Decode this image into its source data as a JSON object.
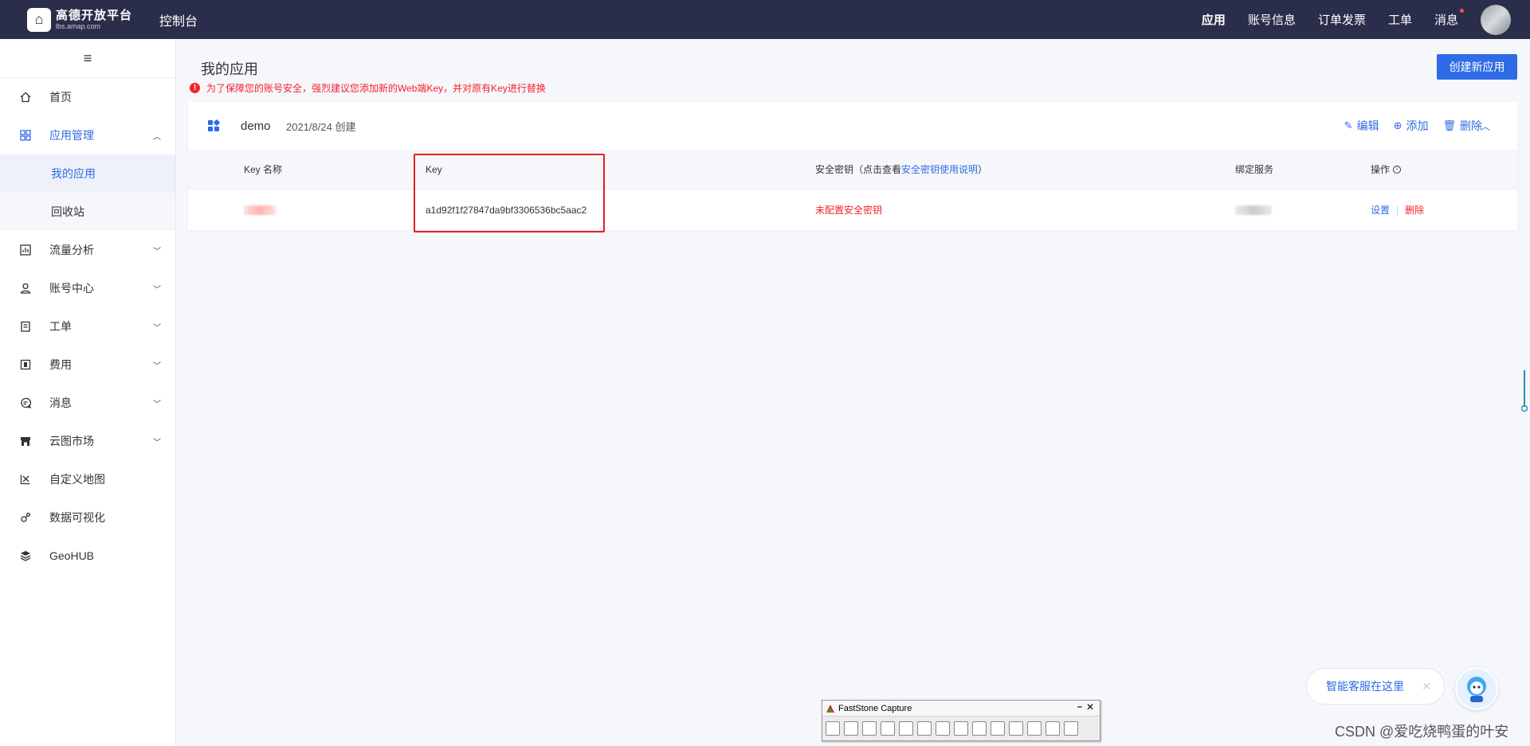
{
  "topbar": {
    "logo_title": "高德开放平台",
    "logo_sub": "lbs.amap.com",
    "console": "控制台",
    "nav": [
      "应用",
      "账号信息",
      "订单发票",
      "工单",
      "消息"
    ]
  },
  "sidebar": {
    "hamburger": "≡",
    "items": {
      "home": "首页",
      "app_manage": "应用管理",
      "my_apps": "我的应用",
      "recycle": "回收站",
      "traffic": "流量分析",
      "account": "账号中心",
      "ticket": "工单",
      "fee": "费用",
      "message": "消息",
      "market": "云图市场",
      "custom_map": "自定义地图",
      "data_vis": "数据可视化",
      "geohub": "GeoHUB"
    }
  },
  "main": {
    "title": "我的应用",
    "create_button": "创建新应用",
    "warning": "为了保障您的账号安全，强烈建议您添加新的Web端Key，并对原有Key进行替换",
    "app": {
      "name": "demo",
      "created": "2021/8/24 创建",
      "actions": {
        "edit": "编辑",
        "add": "添加",
        "delete": "删除"
      }
    },
    "table": {
      "headers": {
        "key_name": "Key 名称",
        "key": "Key",
        "secret_prefix": "安全密钥（点击查看",
        "secret_link": "安全密钥使用说明",
        "secret_suffix": "）",
        "service": "绑定服务",
        "ops": "操作"
      },
      "rows": [
        {
          "key": "a1d92f1f27847da9bf3306536bc5aac2",
          "secret": "未配置安全密钥",
          "op_settings": "设置",
          "op_delete": "删除"
        }
      ]
    }
  },
  "assistant": {
    "label": "智能客服在这里",
    "close": "✕"
  },
  "faststone": {
    "title": "FastStone Capture",
    "min": "–",
    "close": "✕"
  },
  "watermark": "CSDN @爱吃烧鸭蛋的叶安",
  "colors": {
    "topbar": "#2b2e4a",
    "accent": "#2e6be6",
    "danger": "#f5222d"
  }
}
